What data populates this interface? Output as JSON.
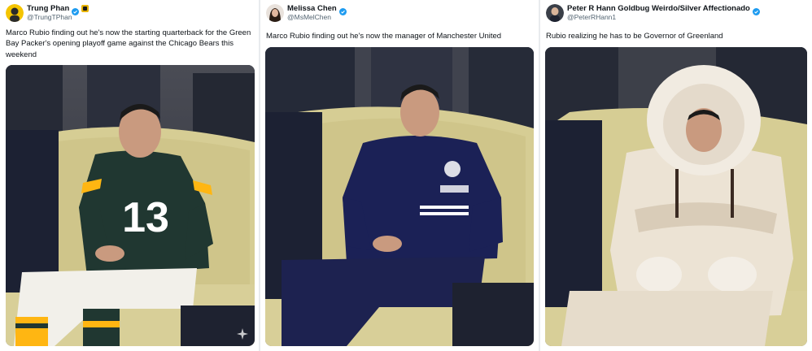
{
  "posts": [
    {
      "name": "Trung Phan",
      "handle": "@TrungTPhan",
      "badge": "affiliate-badge-icon",
      "text": "Marco Rubio finding out he's now the starting quarterback for the Green Bay Packer's opening playoff game against the Chicago Bears this weekend",
      "image": "man-on-couch-in-packers-13-uniform",
      "jersey_number": "13"
    },
    {
      "name": "Melissa Chen",
      "handle": "@MsMelChen",
      "badge": "verified-badge-icon",
      "text": "Marco Rubio finding out he's now the manager of Manchester United",
      "image": "man-on-couch-in-navy-tracksuit"
    },
    {
      "name": "Peter R Hann Goldbug Weirdo/Silver Affectionado",
      "handle": "@PeterRHann1",
      "badge": "verified-badge-icon",
      "text": "Rubio realizing he has to be Governor of Greenland",
      "image": "man-on-couch-in-fur-parka"
    }
  ],
  "colors": {
    "verified": "#1d9bf0",
    "handle": "#536471",
    "packers_green": "#203731",
    "packers_gold": "#ffb612",
    "navy": "#1b2156",
    "couch": "#d8cf98"
  }
}
